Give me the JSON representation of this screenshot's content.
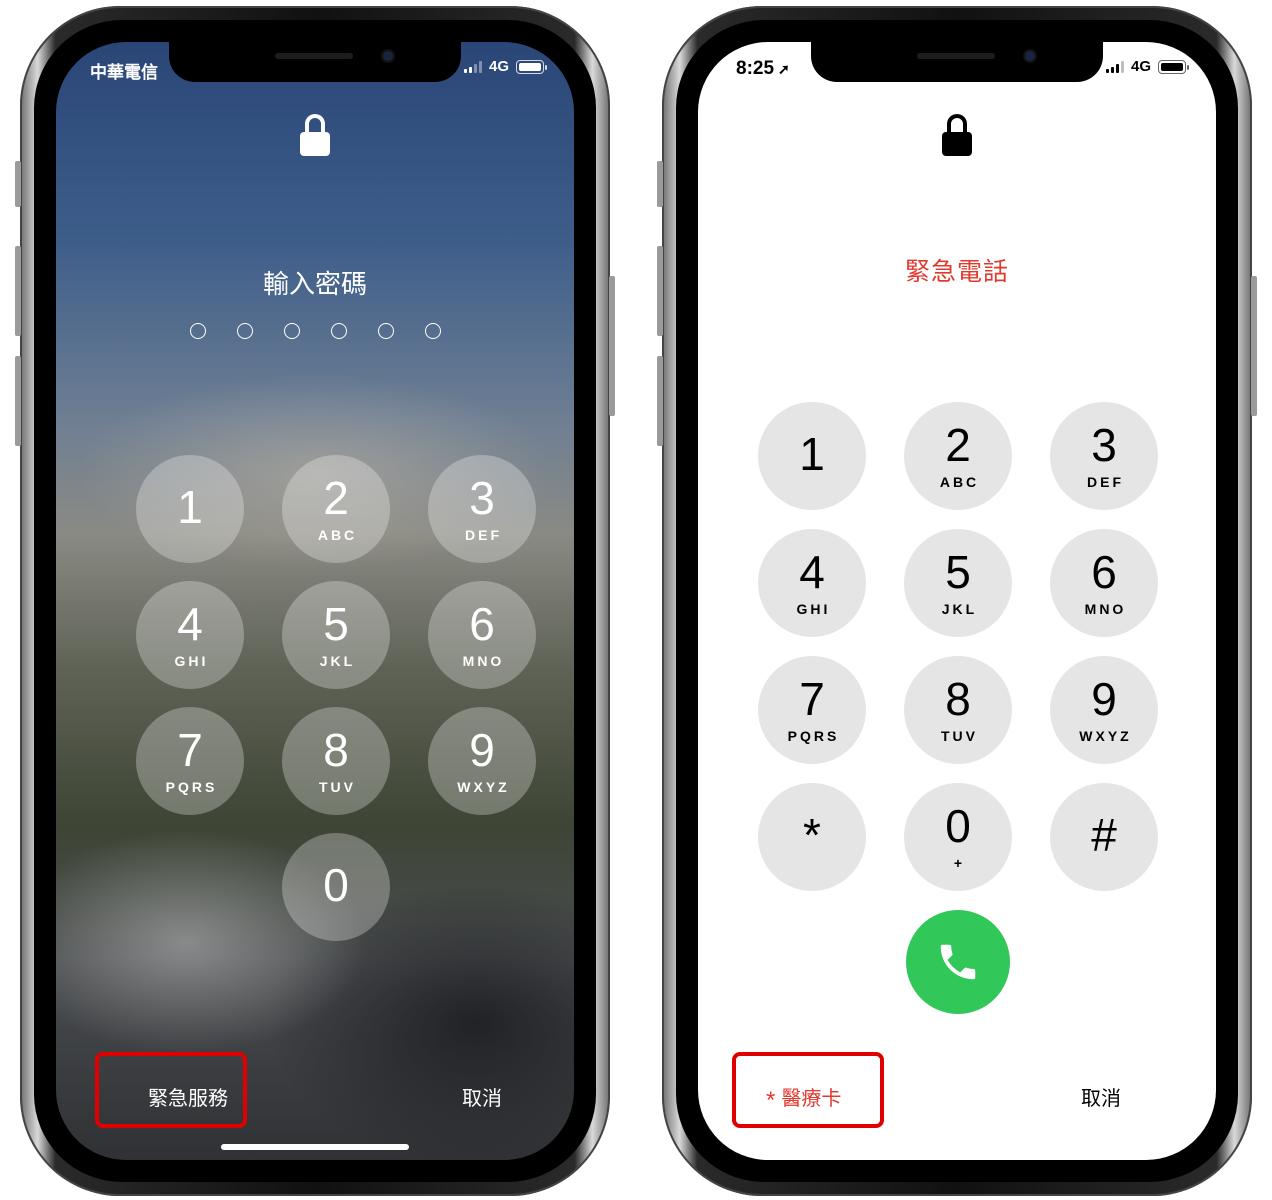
{
  "locked_screen": {
    "carrier": "中華電信",
    "network": "4G",
    "prompt": "輸入密碼",
    "passcode_length": 6,
    "keys": [
      {
        "digit": "1",
        "letters": ""
      },
      {
        "digit": "2",
        "letters": "ABC"
      },
      {
        "digit": "3",
        "letters": "DEF"
      },
      {
        "digit": "4",
        "letters": "GHI"
      },
      {
        "digit": "5",
        "letters": "JKL"
      },
      {
        "digit": "6",
        "letters": "MNO"
      },
      {
        "digit": "7",
        "letters": "PQRS"
      },
      {
        "digit": "8",
        "letters": "TUV"
      },
      {
        "digit": "9",
        "letters": "WXYZ"
      },
      {
        "digit": "0",
        "letters": ""
      }
    ],
    "emergency_label": "緊急服務",
    "cancel_label": "取消"
  },
  "emergency_screen": {
    "time": "8:25",
    "network": "4G",
    "title": "緊急電話",
    "keys": [
      {
        "digit": "1",
        "letters": ""
      },
      {
        "digit": "2",
        "letters": "ABC"
      },
      {
        "digit": "3",
        "letters": "DEF"
      },
      {
        "digit": "4",
        "letters": "GHI"
      },
      {
        "digit": "5",
        "letters": "JKL"
      },
      {
        "digit": "6",
        "letters": "MNO"
      },
      {
        "digit": "7",
        "letters": "PQRS"
      },
      {
        "digit": "8",
        "letters": "TUV"
      },
      {
        "digit": "9",
        "letters": "WXYZ"
      },
      {
        "digit": "*",
        "letters": ""
      },
      {
        "digit": "0",
        "letters": "+"
      },
      {
        "digit": "#",
        "letters": ""
      }
    ],
    "medical_id_asterisk": "*",
    "medical_id_label": "醫療卡",
    "cancel_label": "取消"
  },
  "colors": {
    "emergency_red": "#e2392f",
    "call_green": "#32c759",
    "highlight_red": "#e00000"
  }
}
